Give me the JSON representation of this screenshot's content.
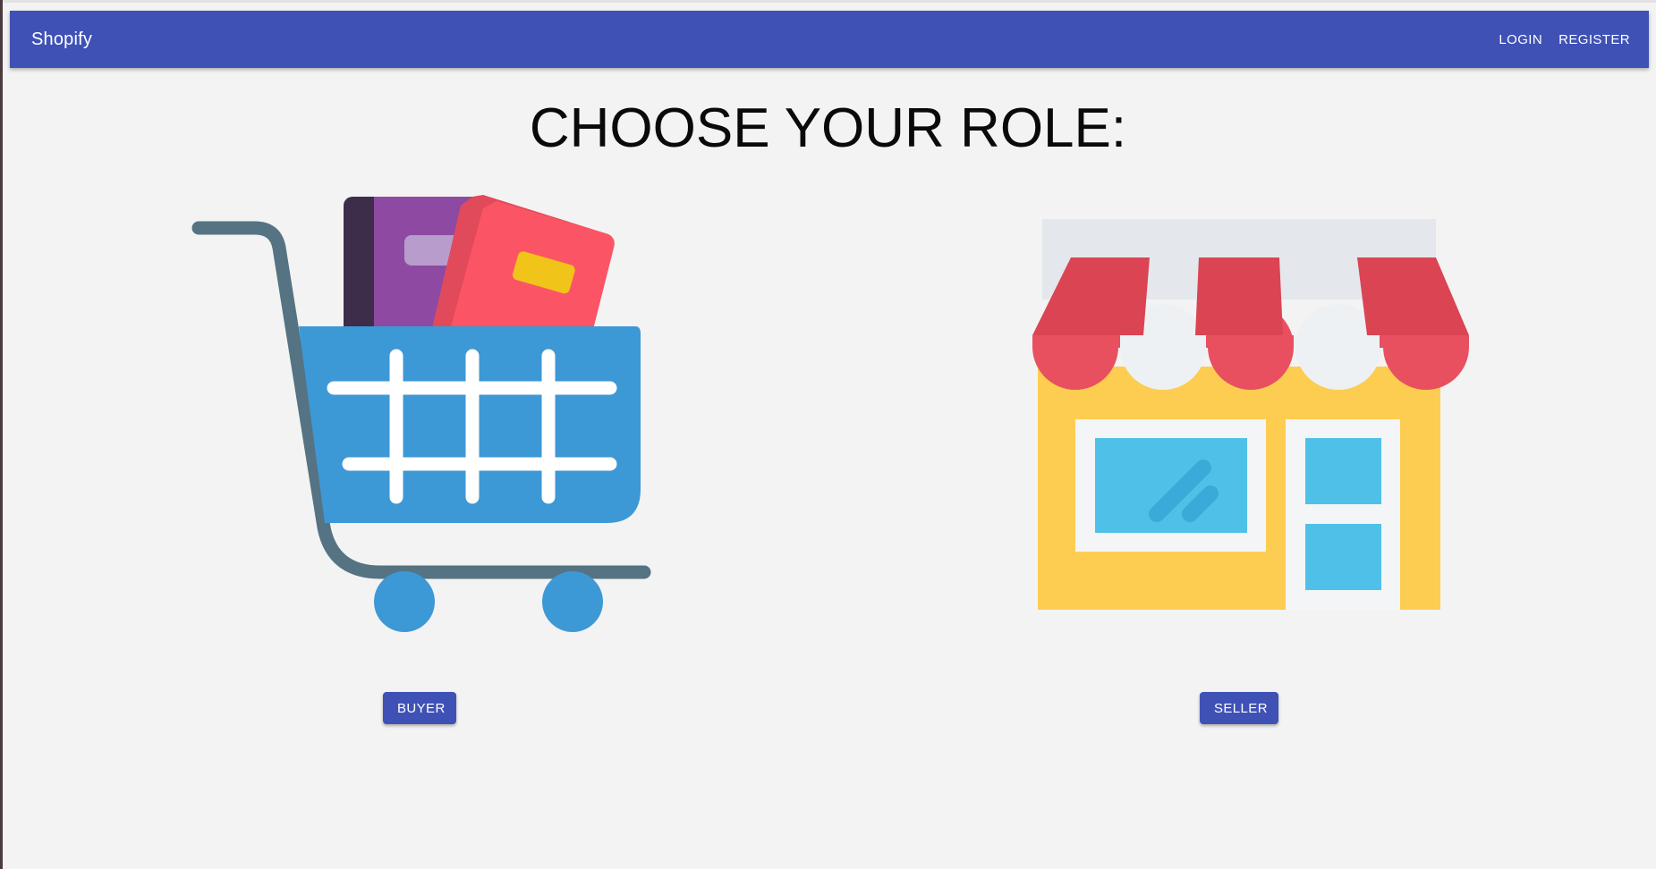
{
  "appbar": {
    "brand": "Shopify",
    "login_label": "LOGIN",
    "register_label": "REGISTER",
    "color": "#3f51b5"
  },
  "main": {
    "title": "CHOOSE YOUR ROLE:",
    "roles": [
      {
        "label": "BUYER",
        "icon": "shopping-cart-icon"
      },
      {
        "label": "SELLER",
        "icon": "storefront-icon"
      }
    ]
  },
  "colors": {
    "background": "#f3f3f3",
    "button": "#3f51b5",
    "cart_basket": "#3d98d6",
    "awning_red": "#e8505f",
    "shop_wall": "#fdcd52",
    "window_blue": "#4fc1e8"
  }
}
